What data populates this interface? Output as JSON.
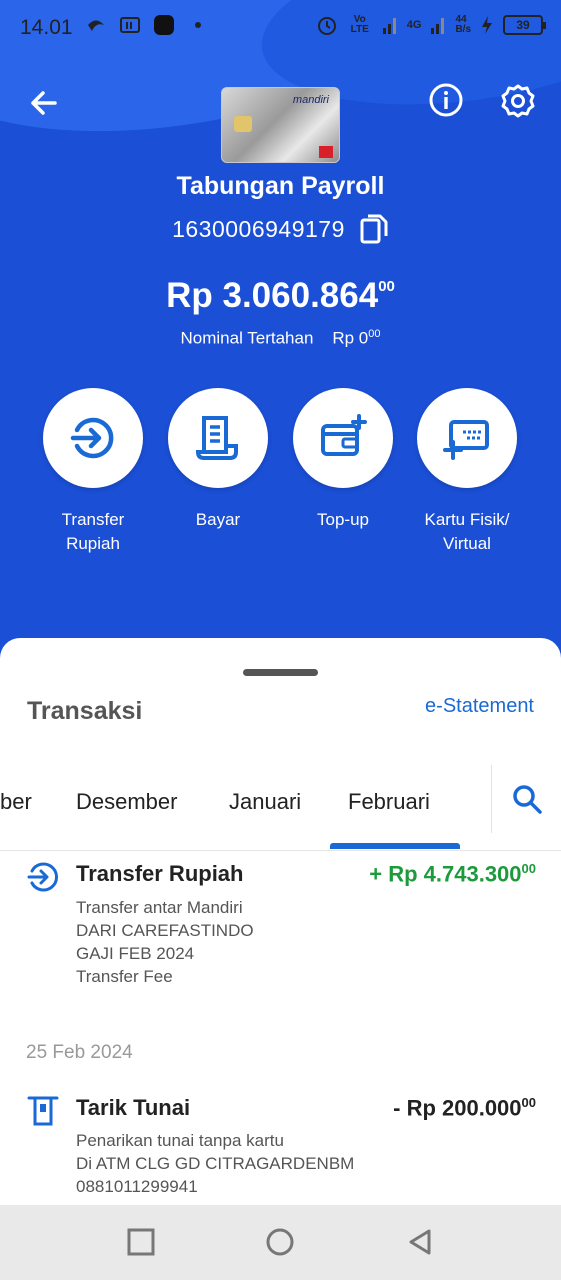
{
  "status_bar": {
    "time": "14.01",
    "network": "4G",
    "speed": "44",
    "speed_unit": "B/s",
    "battery": "39",
    "volte": "Vo LTE"
  },
  "header": {
    "card_brand": "mandiri",
    "account_name": "Tabungan Payroll",
    "account_number": "1630006949179",
    "balance_main": "Rp 3.060.864",
    "balance_cents": "00",
    "held_label": "Nominal Tertahan",
    "held_amount": "Rp 0",
    "held_cents": "00"
  },
  "actions": [
    {
      "label": "Transfer\nRupiah",
      "icon": "transfer-icon"
    },
    {
      "label": "Bayar",
      "icon": "bill-icon"
    },
    {
      "label": "Top-up",
      "icon": "wallet-add-icon"
    },
    {
      "label": "Kartu Fisik/\nVirtual",
      "icon": "card-add-icon"
    }
  ],
  "transactions": {
    "title": "Transaksi",
    "estatement": "e-Statement",
    "tabs": [
      "ber",
      "Desember",
      "Januari",
      "Februari"
    ],
    "active_tab": "Februari",
    "items": [
      {
        "title": "Transfer Rupiah",
        "amount": "+ Rp 4.743.300",
        "cents": "00",
        "type": "credit",
        "lines": [
          "Transfer antar Mandiri",
          "DARI CAREFASTINDO",
          "GAJI FEB 2024",
          "Transfer Fee"
        ]
      },
      {
        "date": "25 Feb 2024",
        "title": "Tarik Tunai",
        "amount": "- Rp 200.000",
        "cents": "00",
        "type": "debit",
        "lines": [
          "Penarikan tunai tanpa kartu",
          "Di ATM CLG GD CITRAGARDENBM",
          "0881011299941"
        ]
      }
    ]
  },
  "colors": {
    "primary": "#1a4fd6",
    "accent": "#1a6ad6",
    "credit": "#1c9a3c"
  }
}
